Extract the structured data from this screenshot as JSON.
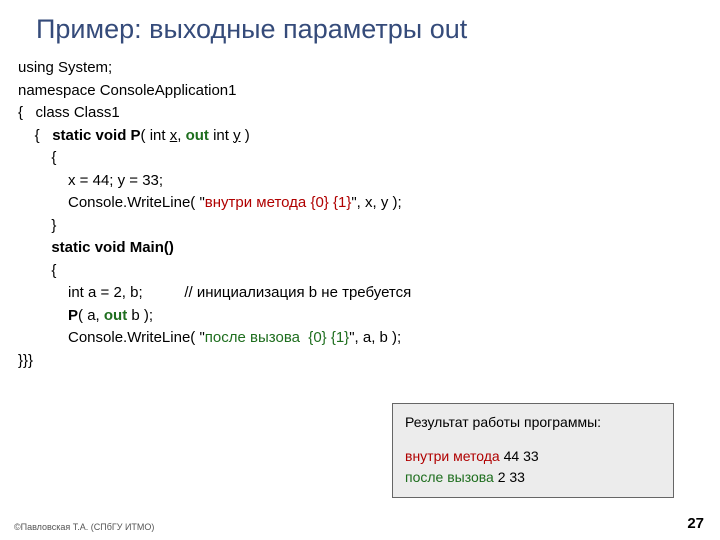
{
  "title": "Пример: выходные параметры out",
  "code": {
    "l1": "using System;",
    "l2": "namespace ConsoleApplication1",
    "l3a": "{   class Class1",
    "l4a": "    {   ",
    "l4b": "static void P",
    "l4c": "( int ",
    "l4x": "x",
    "l4d": ", ",
    "l4out": "out",
    "l4e": " int ",
    "l4y": "y",
    "l4f": " )",
    "l5": "        {",
    "l6": "            x = 44; y = 33;",
    "l7a": "            Console.WriteLine( \"",
    "l7str": "внутри метода {0} {1}",
    "l7b": "\", x, y );",
    "l8": "        }",
    "l9a": "        ",
    "l9b": "static void Main()",
    "l10": "        {",
    "l11": "            int a = 2, b;          // инициализация b не требуется",
    "l12": "",
    "l13a": "            ",
    "l13b": "P",
    "l13c": "( a, ",
    "l13out": "out",
    "l13d": " b );",
    "l14a": "            Console.WriteLine( \"",
    "l14str": "после вызова  {0} {1}",
    "l14b": "\", a, b );",
    "l15": "}}}"
  },
  "result": {
    "title": "Результат работы программы:",
    "line1a": "внутри метода",
    "line1b": " 44 33",
    "line2a": "после вызова",
    "line2b": "  2 33"
  },
  "footer": "©Павловская Т.А. (СПбГУ ИТМО)",
  "page": "27"
}
